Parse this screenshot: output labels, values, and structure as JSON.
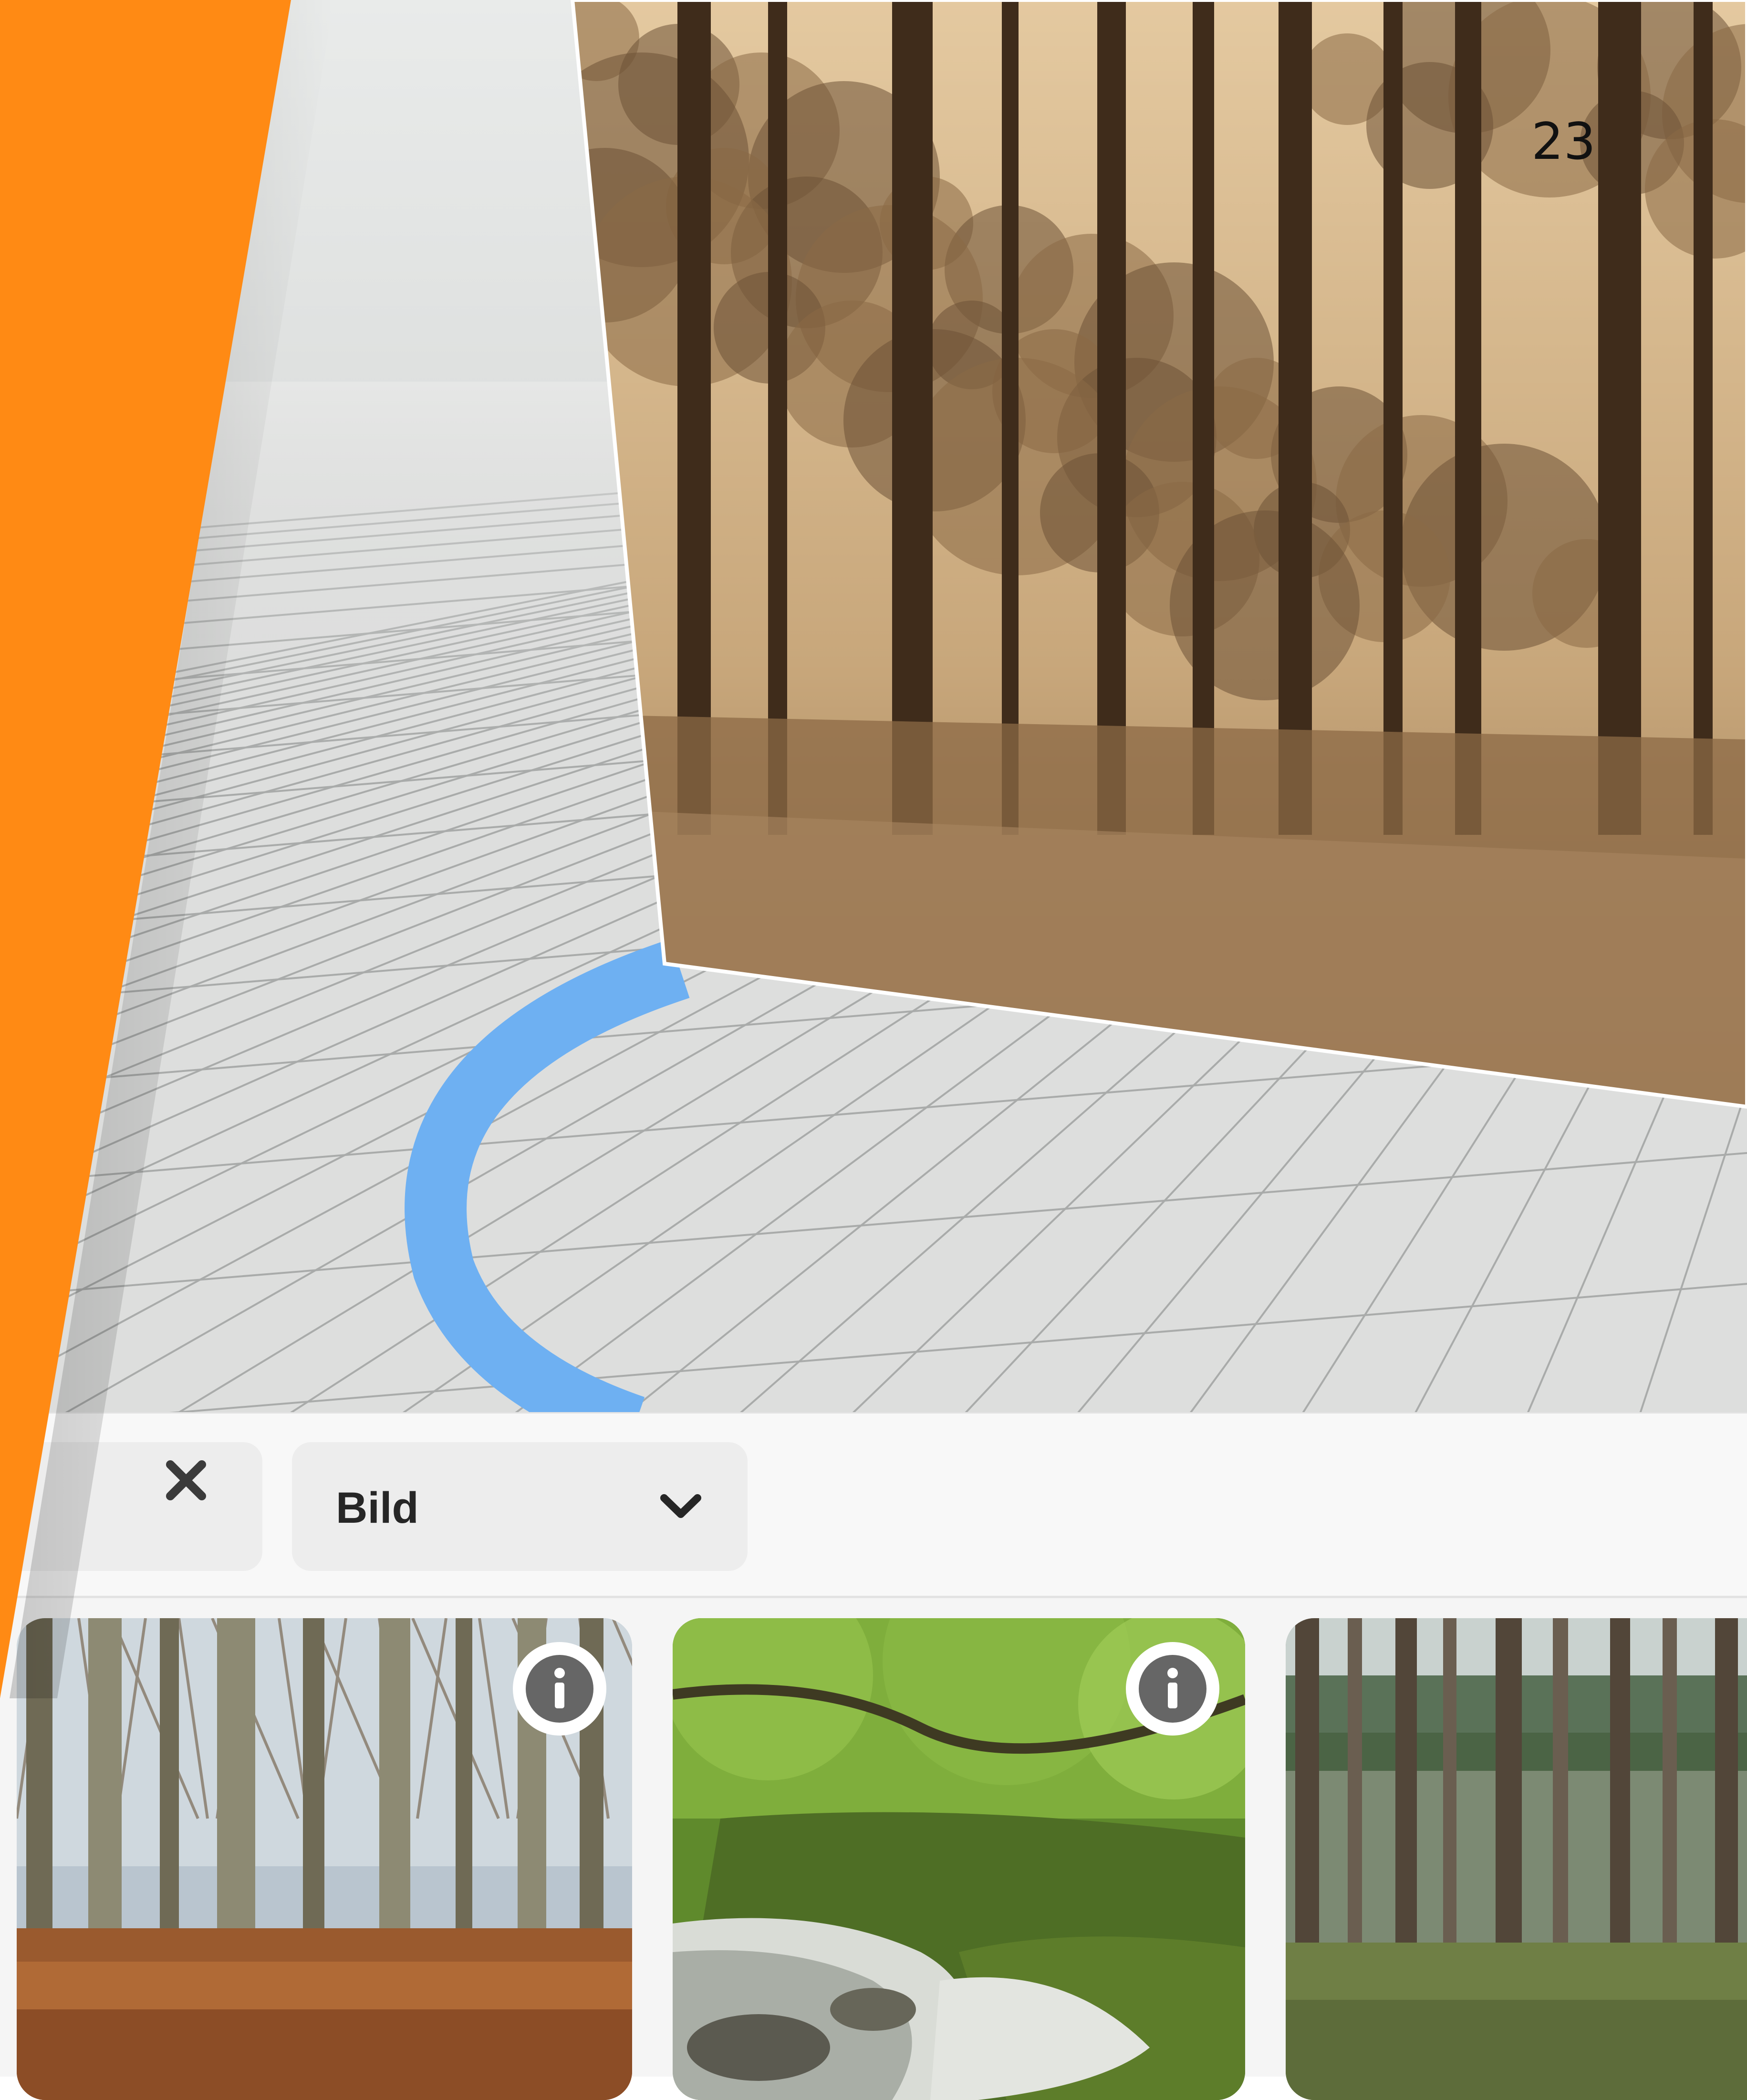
{
  "viewport": {
    "page_number": "23"
  },
  "toolbar": {
    "clear_icon": "close-icon",
    "type_select": {
      "selected": "Bild",
      "icon": "chevron-down-icon"
    }
  },
  "gallery": {
    "items": [
      {
        "scene": "beech-forest-autumn",
        "info_icon": "info-icon"
      },
      {
        "scene": "mossy-forest-stream",
        "info_icon": "info-icon"
      },
      {
        "scene": "pine-forest"
      }
    ]
  },
  "colors": {
    "accent_orange": "#ff8a14",
    "path_blue": "#6eb0f2",
    "sepia_photo": "#b4946a"
  }
}
